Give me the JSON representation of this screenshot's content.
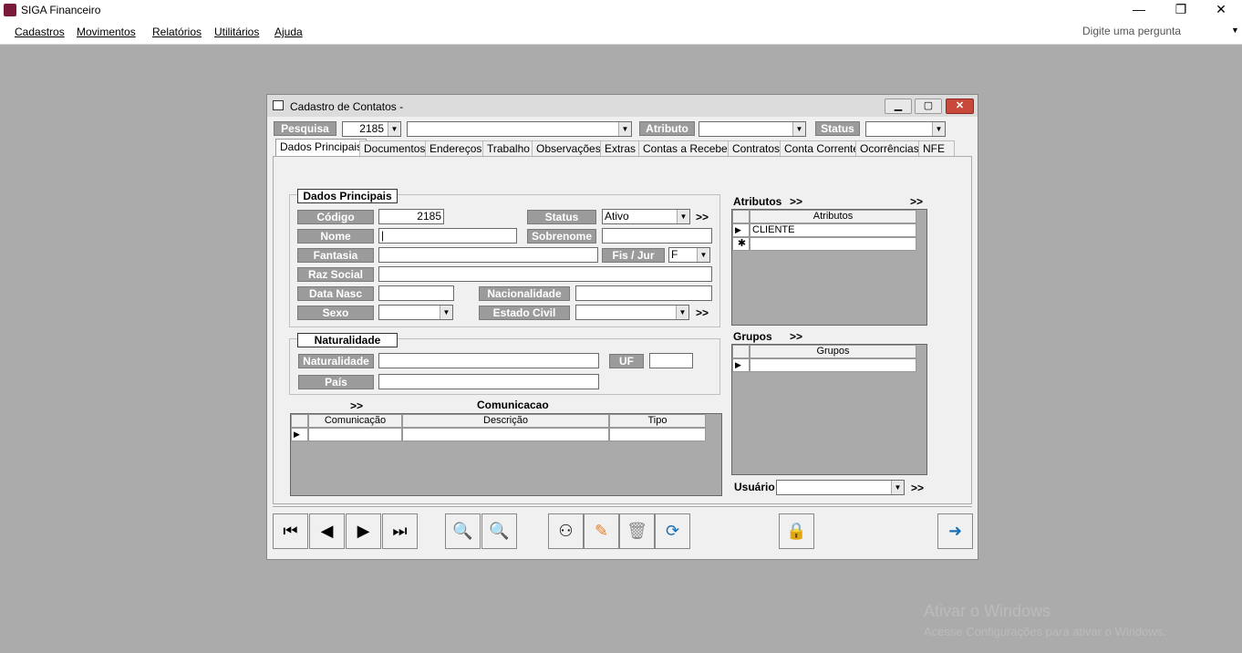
{
  "window": {
    "title": "SIGA Financeiro",
    "minimize": "—",
    "restore": "❐",
    "close": "✕"
  },
  "menu": {
    "items": [
      "Cadastros",
      "Movimentos",
      "Relatórios",
      "Utilitários",
      "Ajuda"
    ],
    "ask_placeholder": "Digite uma pergunta"
  },
  "dialog": {
    "title": "Cadastro de Contatos -",
    "search": {
      "pesquisa_label": "Pesquisa",
      "pesquisa_value": "2185",
      "atributo_label": "Atributo",
      "status_label": "Status"
    },
    "tabs": [
      "Dados Principais",
      "Documentos",
      "Endereços",
      "Trabalho",
      "Observações",
      "Extras",
      "Contas a Receber",
      "Contratos",
      "Conta Corrente",
      "Ocorrências",
      "NFE"
    ],
    "dados": {
      "title": "Dados Principais",
      "codigo_label": "Código",
      "codigo_value": "2185",
      "status_label": "Status",
      "status_value": "Ativo",
      "nome_label": "Nome",
      "sobrenome_label": "Sobrenome",
      "fantasia_label": "Fantasia",
      "fisjur_label": "Fis / Jur",
      "fisjur_value": "F",
      "razao_label": "Raz Social",
      "nasc_label": "Data Nasc",
      "nacionalidade_label": "Nacionalidade",
      "sexo_label": "Sexo",
      "civil_label": "Estado Civil"
    },
    "naturalidade": {
      "title": "Naturalidade",
      "naturalidade_label": "Naturalidade",
      "uf_label": "UF",
      "pais_label": "País"
    },
    "comunicacao": {
      "title": "Comunicacao",
      "chev": ">>",
      "headers": [
        "Comunicação",
        "Descrição",
        "Tipo"
      ]
    },
    "atributos": {
      "title": "Atributos",
      "chev": ">>",
      "header": "Atributos",
      "rows": [
        "CLIENTE"
      ]
    },
    "grupos": {
      "title": "Grupos",
      "chev": ">>",
      "header": "Grupos"
    },
    "usuario_label": "Usuário",
    "chev": ">>"
  },
  "toolbar": {
    "icons": [
      "first-icon",
      "prev-icon",
      "next-icon",
      "last-icon",
      "search-icon",
      "search-advanced-icon",
      "binoculars-icon",
      "edit-icon",
      "delete-icon",
      "refresh-icon",
      "lock-icon",
      "exit-icon"
    ]
  },
  "watermark": {
    "line1": "Ativar o Windows",
    "line2": "Acesse Configurações para ativar o Windows."
  },
  "colors": {
    "label_bg": "#9b9b9b",
    "dialog_bg": "#f0f0f0",
    "desktop_bg": "#ababab",
    "close_red": "#c9483c"
  }
}
